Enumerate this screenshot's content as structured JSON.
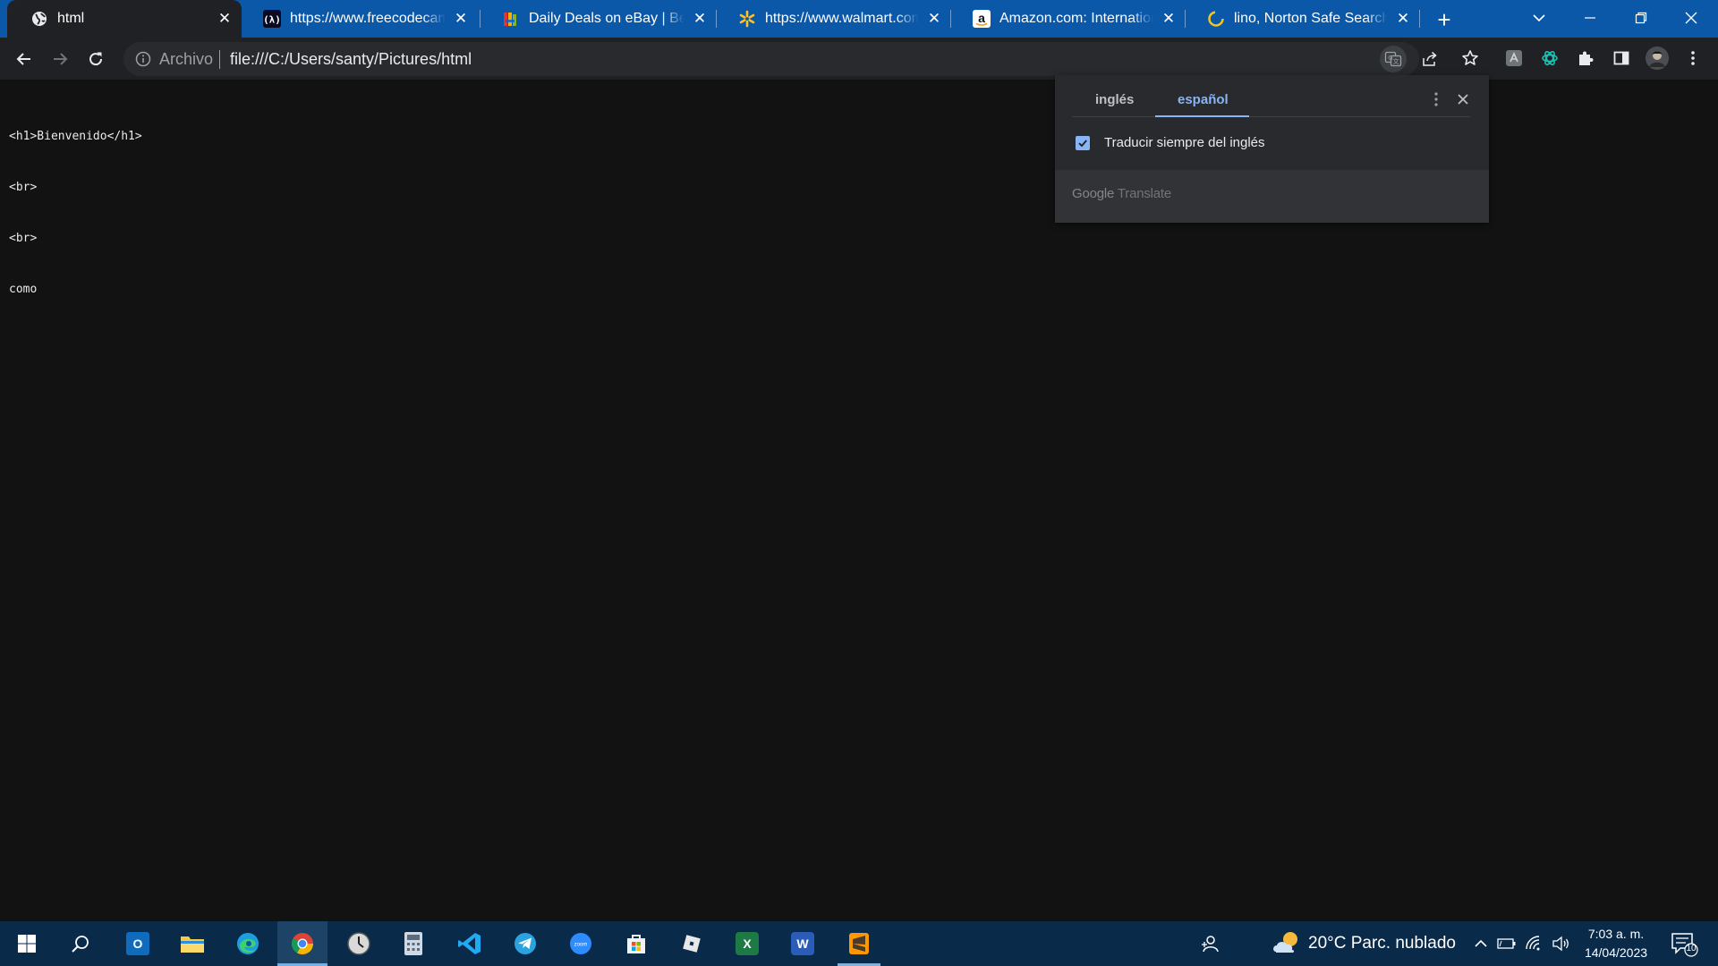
{
  "browser": {
    "tabs": [
      {
        "title": "html",
        "favicon": "globe-icon",
        "active": true
      },
      {
        "title": "https://www.freecodecamp.org",
        "favicon": "freecodecamp-icon",
        "active": false
      },
      {
        "title": "Daily Deals on eBay | Best deals",
        "favicon": "ebay-icon",
        "active": false
      },
      {
        "title": "https://www.walmart.com/search",
        "favicon": "walmart-icon",
        "active": false
      },
      {
        "title": "Amazon.com: International",
        "favicon": "amazon-icon",
        "active": false
      },
      {
        "title": "lino, Norton Safe Search",
        "favicon": "norton-loading-icon",
        "active": false
      }
    ],
    "omnibox": {
      "scheme_label": "Archivo",
      "url": "file:///C:/Users/santy/Pictures/html"
    }
  },
  "page": {
    "lines": [
      "<h1>Bienvenido</h1>",
      "<br>",
      "<br>",
      "como"
    ]
  },
  "translate_bubble": {
    "source_language": "inglés",
    "target_language": "español",
    "always_translate_label": "Traducir siempre del inglés",
    "always_translate_checked": true,
    "footer_google": "Google",
    "footer_translate": "Translate"
  },
  "taskbar": {
    "weather": "20°C  Parc. nublado",
    "time": "7:03 a. m.",
    "date": "14/04/2023",
    "notification_count": "10"
  },
  "colors": {
    "tabstrip": "#0b57a8",
    "toolbar": "#202124",
    "accent_blue": "#8ab4f8",
    "taskbar": "#0a2a4a"
  }
}
